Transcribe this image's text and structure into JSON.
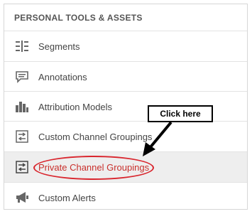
{
  "section": {
    "title": "PERSONAL TOOLS & ASSETS"
  },
  "menu": {
    "items": [
      {
        "label": "Segments",
        "icon": "segments-icon"
      },
      {
        "label": "Annotations",
        "icon": "annotation-icon"
      },
      {
        "label": "Attribution Models",
        "icon": "bar-chart-icon"
      },
      {
        "label": "Custom Channel Groupings",
        "icon": "channel-grouping-icon"
      },
      {
        "label": "Private Channel Groupings",
        "icon": "channel-grouping-icon",
        "highlighted": true
      },
      {
        "label": "Custom Alerts",
        "icon": "megaphone-icon"
      }
    ]
  },
  "callout": {
    "text": "Click here"
  },
  "colors": {
    "highlight": "#d9262e",
    "active_row": "#eeeeee",
    "active_label": "#c9302c"
  }
}
